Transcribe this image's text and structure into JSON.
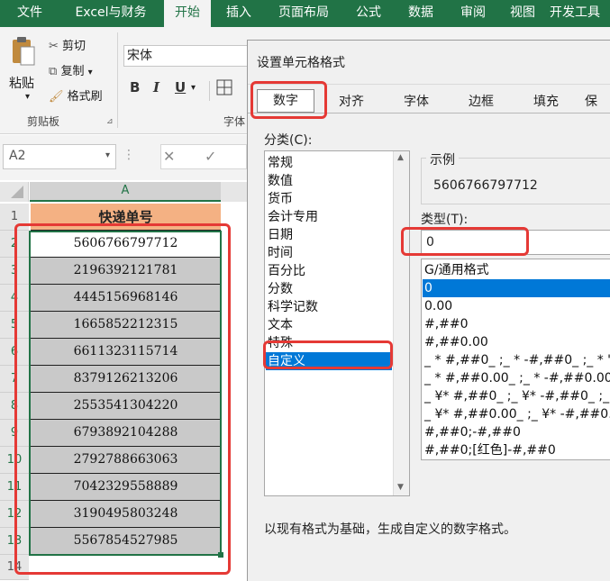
{
  "tabs": [
    "文件",
    "Excel与财务",
    "开始",
    "插入",
    "页面布局",
    "公式",
    "数据",
    "审阅",
    "视图",
    "开发工具"
  ],
  "clipboard": {
    "paste": "粘贴",
    "cut": "剪切",
    "copy": "复制",
    "painter": "格式刷",
    "group": "剪贴板"
  },
  "font": {
    "name": "宋体",
    "group": "字体"
  },
  "name_box": "A2",
  "sheet": {
    "column": "A",
    "header": "快递单号",
    "row_numbers": [
      "1",
      "2",
      "3",
      "4",
      "5",
      "6",
      "7",
      "8",
      "9",
      "10",
      "11",
      "12",
      "13",
      "14"
    ],
    "values": [
      "5606766797712",
      "2196392121781",
      "4445156968146",
      "1665852212315",
      "6611323115714",
      "8379126213206",
      "2553541304220",
      "6793892104288",
      "2792788663063",
      "7042329558889",
      "3190495803248",
      "5567854527985"
    ]
  },
  "dialog": {
    "title": "设置单元格格式",
    "tabs": [
      "数字",
      "对齐",
      "字体",
      "边框",
      "填充",
      "保"
    ],
    "category_label": "分类(C):",
    "categories": [
      "常规",
      "数值",
      "货币",
      "会计专用",
      "日期",
      "时间",
      "百分比",
      "分数",
      "科学记数",
      "文本",
      "特殊",
      "自定义"
    ],
    "selected_category": "自定义",
    "sample_label": "示例",
    "sample_value": "5606766797712",
    "type_label": "类型(T):",
    "type_value": "0",
    "formats": [
      "G/通用格式",
      "0",
      "0.00",
      "#,##0",
      "#,##0.00",
      "_ * #,##0_ ;_ * -#,##0_ ;_ * \"-\"",
      "_ * #,##0.00_ ;_ * -#,##0.00_",
      "_ ¥* #,##0_ ;_ ¥* -#,##0_ ;_ ¥",
      "_ ¥* #,##0.00_ ;_ ¥* -#,##0.00",
      "#,##0;-#,##0",
      "#,##0;[红色]-#,##0"
    ],
    "selected_format": "0",
    "description": "以现有格式为基础，生成自定义的数字格式。"
  },
  "colors": {
    "excel_green": "#217346",
    "selection_blue": "#0078d7",
    "annotation_red": "#e53935"
  }
}
